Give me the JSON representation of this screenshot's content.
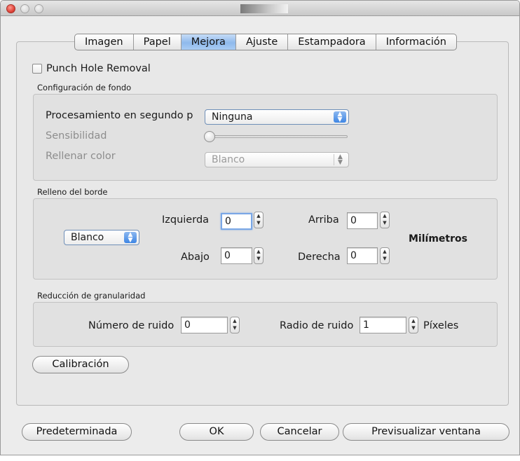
{
  "tabs": [
    "Imagen",
    "Papel",
    "Mejora",
    "Ajuste",
    "Estampadora",
    "Información"
  ],
  "active_tab": "Mejora",
  "punch_hole": {
    "label": "Punch Hole Removal",
    "checked": false
  },
  "background_group": {
    "title": "Configuración de fondo",
    "processing_label": "Procesamiento en segundo p",
    "processing_value": "Ninguna",
    "sensitivity_label": "Sensibilidad",
    "fill_color_label": "Rellenar color",
    "fill_color_value": "Blanco",
    "sensitivity_level": 0
  },
  "border_group": {
    "title": "Relleno del borde",
    "color_value": "Blanco",
    "left_label": "Izquierda",
    "left_value": "0",
    "top_label": "Arriba",
    "top_value": "0",
    "bottom_label": "Abajo",
    "bottom_value": "0",
    "right_label": "Derecha",
    "right_value": "0",
    "unit": "Milímetros"
  },
  "grain_group": {
    "title": "Reducción de granularidad",
    "noise_number_label": "Número de ruido",
    "noise_number_value": "0",
    "noise_radius_label": "Radio de ruido",
    "noise_radius_value": "1",
    "unit": "Píxeles"
  },
  "buttons": {
    "calibration": "Calibración",
    "default": "Predeterminada",
    "ok": "OK",
    "cancel": "Cancelar",
    "preview": "Previsualizar ventana"
  },
  "colors": {
    "active_tab": "#9fc3f0",
    "popup_arrows": "#3f86e4",
    "close_button": "#e0443a",
    "focus_ring": "#7aa7e6"
  }
}
